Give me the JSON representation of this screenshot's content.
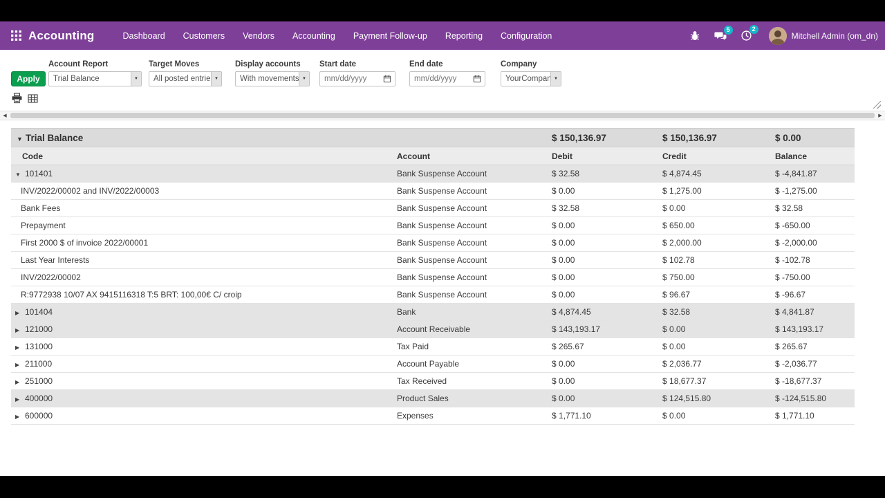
{
  "colors": {
    "navbar": "#7d3f98",
    "apply_button": "#0a9e4e",
    "badge": "#18b7c9"
  },
  "icons": {
    "caret_down": "▼",
    "caret_right": "▶",
    "select_caret": "▼",
    "scroll_left": "◀",
    "scroll_right": "▶"
  },
  "nav": {
    "app_name": "Accounting",
    "menu": [
      "Dashboard",
      "Customers",
      "Vendors",
      "Accounting",
      "Payment Follow-up",
      "Reporting",
      "Configuration"
    ],
    "messages_badge": "5",
    "activities_badge": "2",
    "user_name": "Mitchell Admin (om_dn)"
  },
  "filters": {
    "apply_label": "Apply",
    "fields": [
      {
        "label": "Account Report",
        "value": "Trial Balance",
        "type": "select"
      },
      {
        "label": "Target Moves",
        "value": "All posted entries",
        "type": "select"
      },
      {
        "label": "Display accounts",
        "value": "With movements",
        "type": "select"
      },
      {
        "label": "Start date",
        "value": "",
        "placeholder": "mm/dd/yyyy",
        "type": "date"
      },
      {
        "label": "End date",
        "value": "",
        "placeholder": "mm/dd/yyyy",
        "type": "date"
      },
      {
        "label": "Company",
        "value": "YourCompany",
        "type": "select"
      }
    ]
  },
  "report": {
    "title": "Trial Balance",
    "totals": {
      "debit": "$ 150,136.97",
      "credit": "$ 150,136.97",
      "balance": "$ 0.00"
    },
    "columns": [
      "Code",
      "Account",
      "Debit",
      "Credit",
      "Balance"
    ],
    "rows": [
      {
        "caret": "down",
        "label": "101401",
        "account": "Bank Suspense Account",
        "debit": "$ 32.58",
        "credit": "$ 4,874.45",
        "balance": "$ -4,841.87",
        "shaded": true,
        "child": false
      },
      {
        "caret": "none",
        "label": "INV/2022/00002 and INV/2022/00003",
        "account": "Bank Suspense Account",
        "debit": "$ 0.00",
        "credit": "$ 1,275.00",
        "balance": "$ -1,275.00",
        "shaded": false,
        "child": true
      },
      {
        "caret": "none",
        "label": "Bank Fees",
        "account": "Bank Suspense Account",
        "debit": "$ 32.58",
        "credit": "$ 0.00",
        "balance": "$ 32.58",
        "shaded": false,
        "child": true
      },
      {
        "caret": "none",
        "label": "Prepayment",
        "account": "Bank Suspense Account",
        "debit": "$ 0.00",
        "credit": "$ 650.00",
        "balance": "$ -650.00",
        "shaded": false,
        "child": true
      },
      {
        "caret": "none",
        "label": "First 2000 $ of invoice 2022/00001",
        "account": "Bank Suspense Account",
        "debit": "$ 0.00",
        "credit": "$ 2,000.00",
        "balance": "$ -2,000.00",
        "shaded": false,
        "child": true
      },
      {
        "caret": "none",
        "label": "Last Year Interests",
        "account": "Bank Suspense Account",
        "debit": "$ 0.00",
        "credit": "$ 102.78",
        "balance": "$ -102.78",
        "shaded": false,
        "child": true
      },
      {
        "caret": "none",
        "label": "INV/2022/00002",
        "account": "Bank Suspense Account",
        "debit": "$ 0.00",
        "credit": "$ 750.00",
        "balance": "$ -750.00",
        "shaded": false,
        "child": true
      },
      {
        "caret": "none",
        "label": "R:9772938 10/07 AX 9415116318 T:5 BRT: 100,00€ C/ croip",
        "account": "Bank Suspense Account",
        "debit": "$ 0.00",
        "credit": "$ 96.67",
        "balance": "$ -96.67",
        "shaded": false,
        "child": true
      },
      {
        "caret": "right",
        "label": "101404",
        "account": "Bank",
        "debit": "$ 4,874.45",
        "credit": "$ 32.58",
        "balance": "$ 4,841.87",
        "shaded": true,
        "child": false
      },
      {
        "caret": "right",
        "label": "121000",
        "account": "Account Receivable",
        "debit": "$ 143,193.17",
        "credit": "$ 0.00",
        "balance": "$ 143,193.17",
        "shaded": true,
        "child": false
      },
      {
        "caret": "right",
        "label": "131000",
        "account": "Tax Paid",
        "debit": "$ 265.67",
        "credit": "$ 0.00",
        "balance": "$ 265.67",
        "shaded": false,
        "child": false
      },
      {
        "caret": "right",
        "label": "211000",
        "account": "Account Payable",
        "debit": "$ 0.00",
        "credit": "$ 2,036.77",
        "balance": "$ -2,036.77",
        "shaded": false,
        "child": false
      },
      {
        "caret": "right",
        "label": "251000",
        "account": "Tax Received",
        "debit": "$ 0.00",
        "credit": "$ 18,677.37",
        "balance": "$ -18,677.37",
        "shaded": false,
        "child": false
      },
      {
        "caret": "right",
        "label": "400000",
        "account": "Product Sales",
        "debit": "$ 0.00",
        "credit": "$ 124,515.80",
        "balance": "$ -124,515.80",
        "shaded": true,
        "child": false
      },
      {
        "caret": "right",
        "label": "600000",
        "account": "Expenses",
        "debit": "$ 1,771.10",
        "credit": "$ 0.00",
        "balance": "$ 1,771.10",
        "shaded": false,
        "child": false
      }
    ]
  }
}
